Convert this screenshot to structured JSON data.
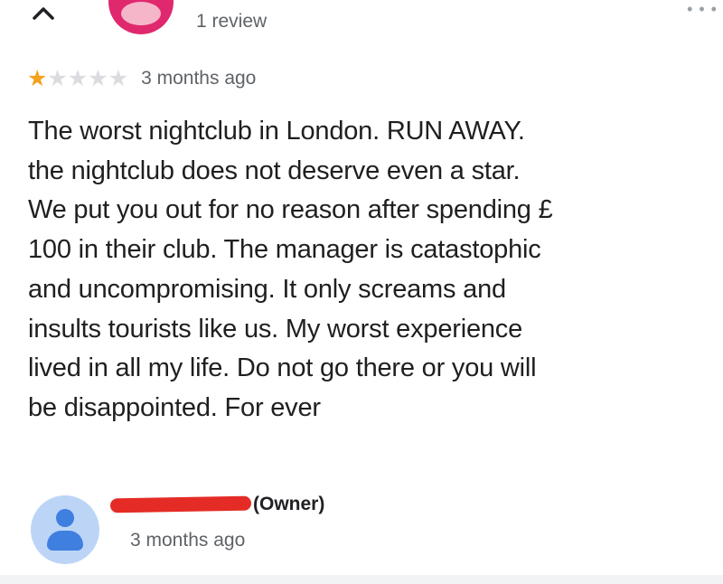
{
  "header": {
    "review_count": "1 review",
    "collapse_icon": "chevron-up-icon",
    "more_icon": "more-options-icon"
  },
  "rating": {
    "stars": 1,
    "max_stars": 5,
    "star_color": "#f4a11b",
    "time": "3 months ago"
  },
  "review": {
    "text": "The worst nightclub in London. RUN AWAY.\nthe nightclub does not deserve even a star.\nWe put you out for no reason after spending £\n100 in their club. The manager is catastophic\nand uncompromising. It only screams and\ninsults tourists like us. My worst experience\nlived in all my life. Do not go there or you will\nbe disappointed. For ever"
  },
  "owner_response": {
    "label": "(Owner)",
    "time": "3 months ago",
    "redaction_color": "#e52b25",
    "avatar_color": "#bcd5f7"
  }
}
